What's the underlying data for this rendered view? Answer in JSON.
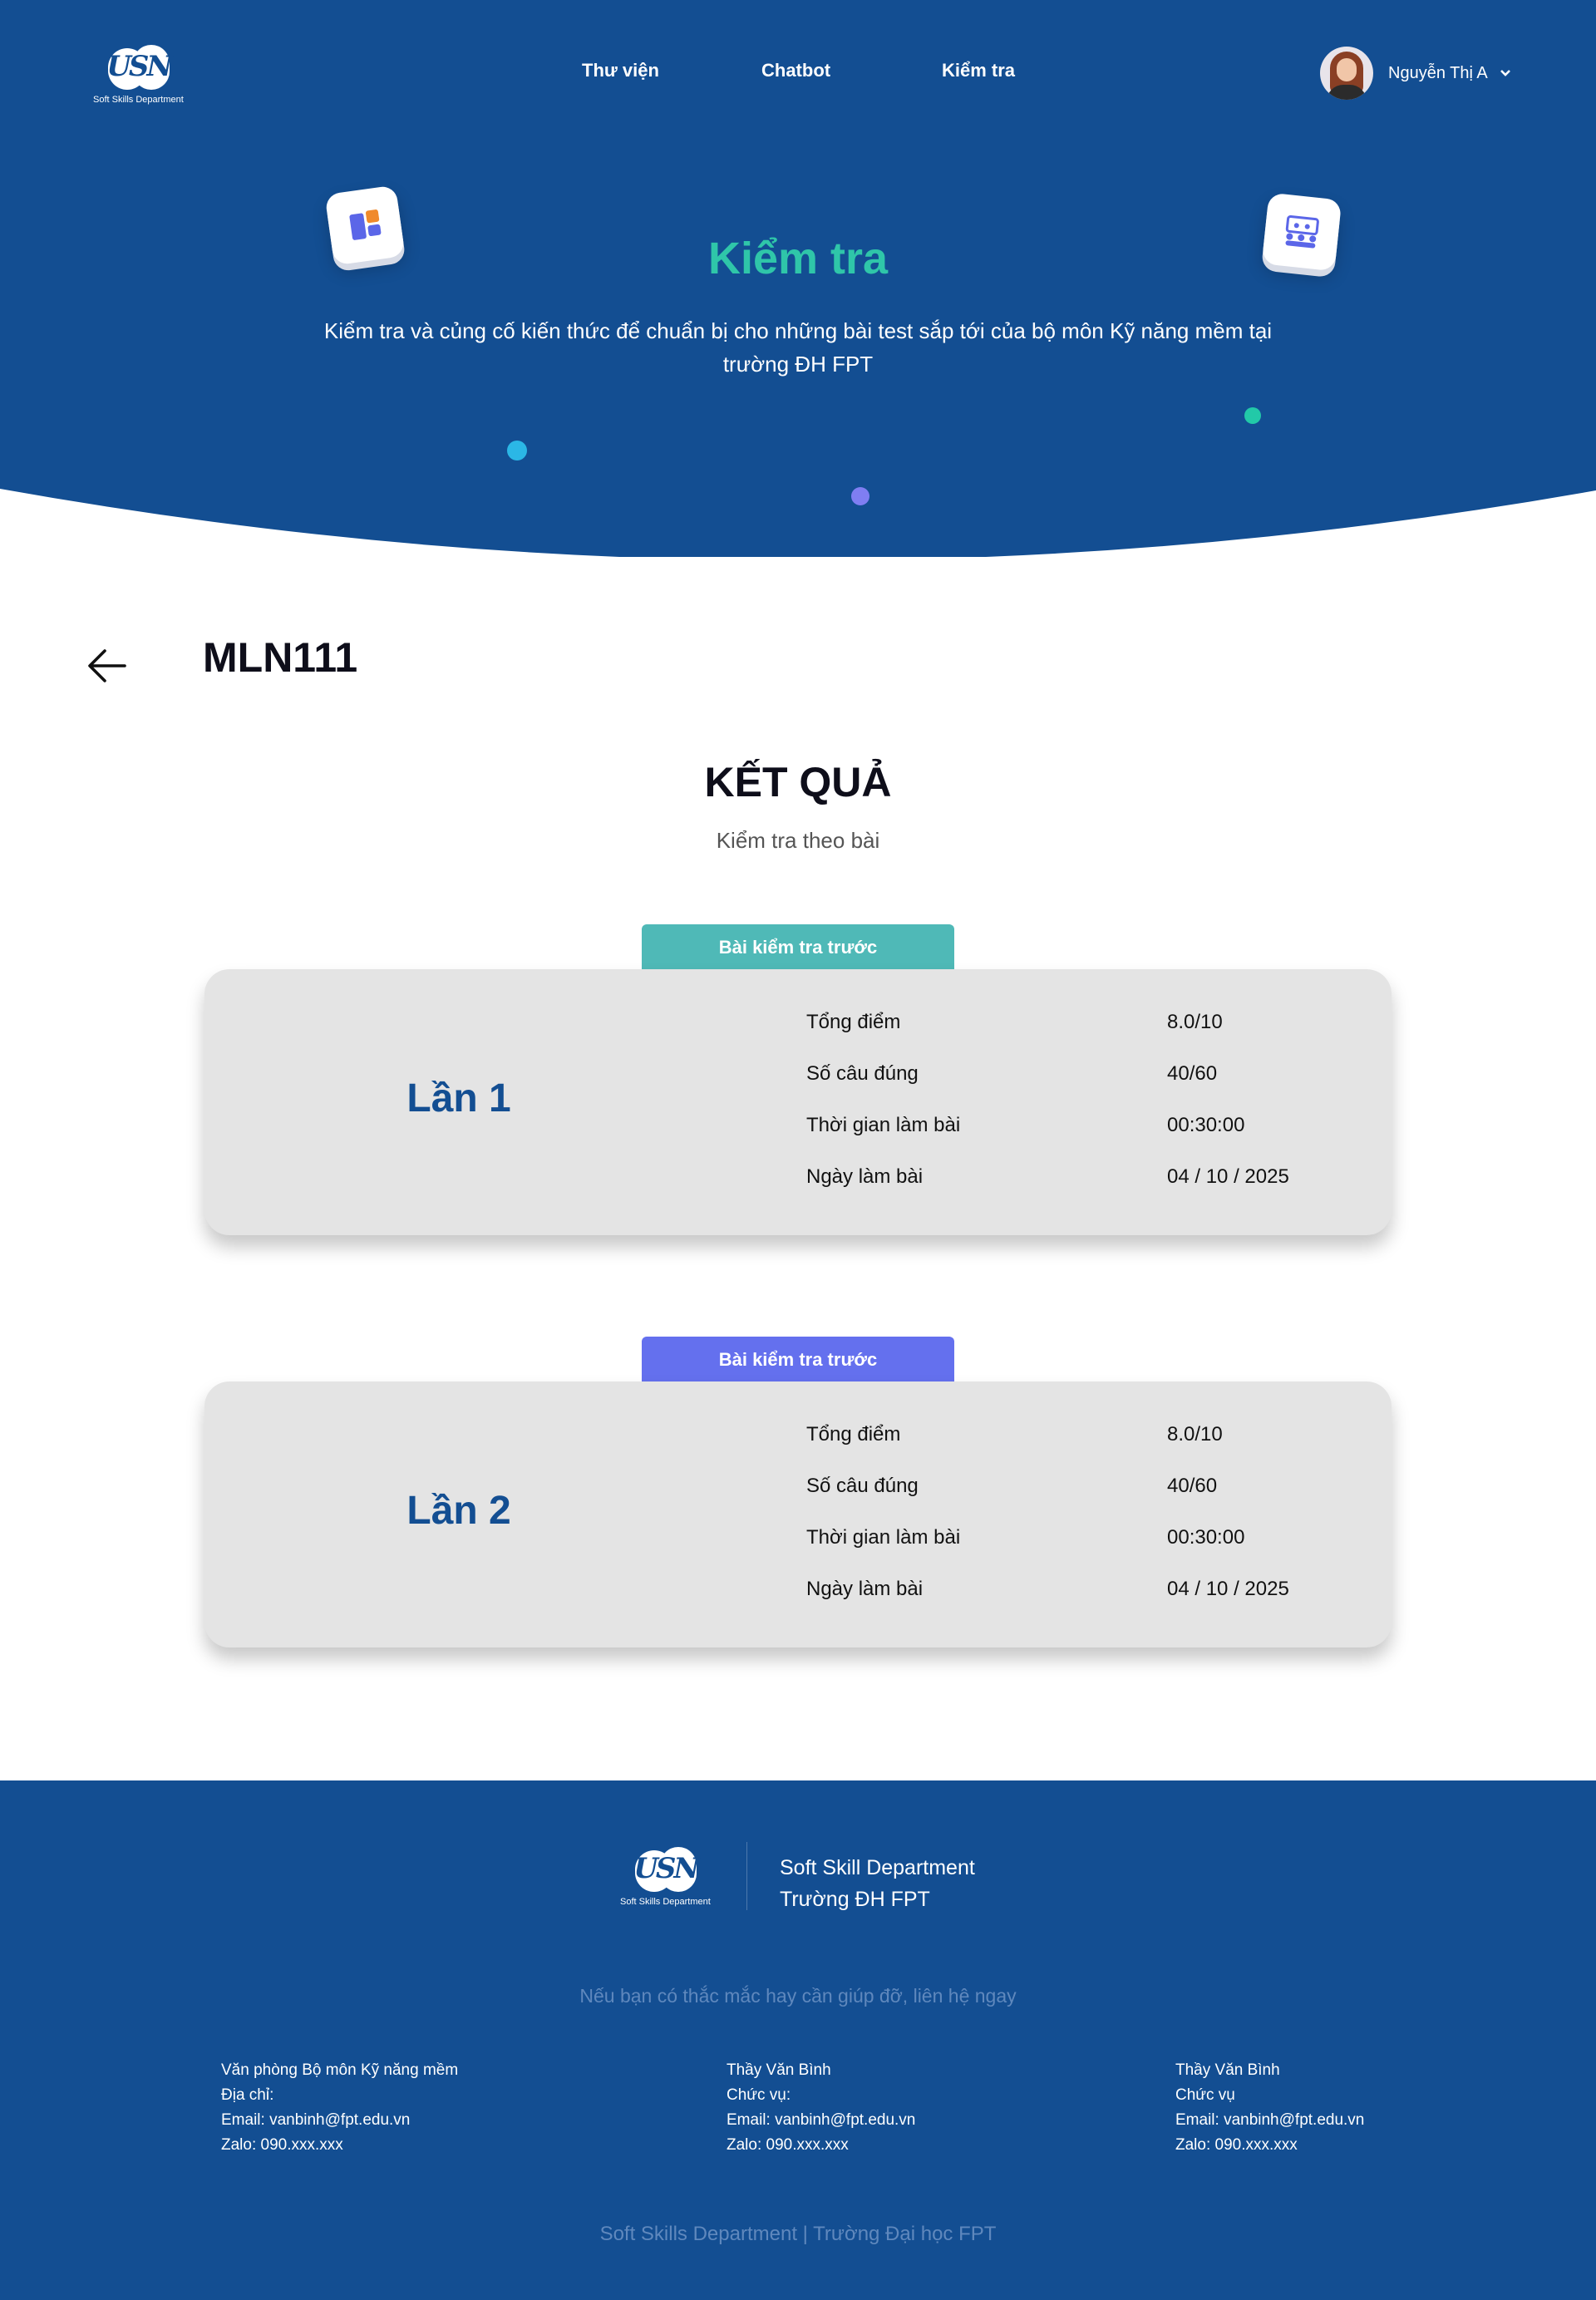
{
  "brand": {
    "logo_text": "USN",
    "logo_caption": "Soft Skills Department",
    "blue": "#134e92",
    "teal": "#2fc6a9"
  },
  "nav": {
    "items": [
      "Thư viện",
      "Chatbot",
      "Kiểm tra"
    ]
  },
  "user": {
    "name": "Nguyễn Thị A",
    "menu_icon": "chevron-down-icon"
  },
  "hero": {
    "title": "Kiểm tra",
    "description": "Kiểm tra và củng cố kiến thức để chuẩn bị cho những bài test sắp tới của bộ môn Kỹ năng mềm tại trường ĐH FPT",
    "left_tile_icon": "dashboard-icon",
    "right_tile_icon": "classroom-icon"
  },
  "page": {
    "back_icon": "arrow-left-icon",
    "course_code": "MLN111",
    "result_title": "KẾT QUẢ",
    "result_subtitle": "Kiểm tra theo bài"
  },
  "attempts": [
    {
      "tab": "Bài kiểm tra trước",
      "tab_color": "#4fb9b7",
      "label": "Lần 1",
      "rows": [
        {
          "label": "Tổng điểm",
          "value": "8.0/10"
        },
        {
          "label": "Số câu đúng",
          "value": "40/60"
        },
        {
          "label": "Thời gian làm bài",
          "value": "00:30:00"
        },
        {
          "label": "Ngày làm bài",
          "value": "04 / 10 / 2025"
        }
      ]
    },
    {
      "tab": "Bài kiểm tra trước",
      "tab_color": "#6470ee",
      "label": "Lần 2",
      "rows": [
        {
          "label": "Tổng điểm",
          "value": "8.0/10"
        },
        {
          "label": "Số câu đúng",
          "value": "40/60"
        },
        {
          "label": "Thời gian làm bài",
          "value": "00:30:00"
        },
        {
          "label": "Ngày làm bài",
          "value": "04 / 10 / 2025"
        }
      ]
    }
  ],
  "footer": {
    "org_line1": "Soft Skill Department",
    "org_line2": "Trường ĐH FPT",
    "help_text": "Nếu bạn có thắc mắc hay cần giúp đỡ, liên hệ ngay",
    "contacts": [
      [
        "Văn phòng Bộ môn Kỹ năng mềm",
        "Địa chỉ:",
        "Email: vanbinh@fpt.edu.vn",
        "Zalo: 090.xxx.xxx"
      ],
      [
        "Thầy Văn Bình",
        "Chức vụ:",
        "Email: vanbinh@fpt.edu.vn",
        "Zalo: 090.xxx.xxx"
      ],
      [
        "Thầy Văn Bình",
        "Chức vụ",
        "Email: vanbinh@fpt.edu.vn",
        "Zalo: 090.xxx.xxx"
      ]
    ],
    "copyright": "Soft Skills Department | Trường Đại học FPT"
  }
}
